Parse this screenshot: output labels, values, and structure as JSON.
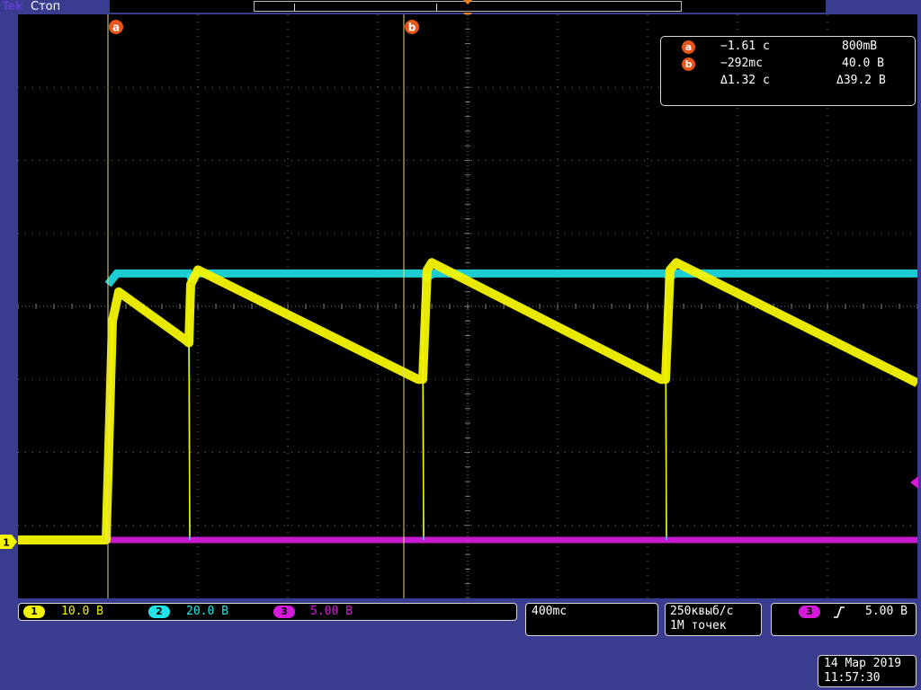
{
  "top": {
    "logo": "Tek",
    "state": "Стоп"
  },
  "cursors": {
    "a_label": "a",
    "b_label": "b",
    "a_time": "−1.61 с",
    "a_value": "800mB",
    "b_time": "−292mс",
    "b_value": "40.0 B",
    "delta_time": "Δ1.32 с",
    "delta_value": "Δ39.2 B"
  },
  "channels": [
    {
      "num": "1",
      "scale": "10.0 B",
      "color": "#f5f500"
    },
    {
      "num": "2",
      "scale": "20.0 B",
      "color": "#1ee3e8"
    },
    {
      "num": "3",
      "scale": "5.00 B",
      "color": "#d21ad8"
    }
  ],
  "ground_marker": "1",
  "horizontal": {
    "scale": "400mс"
  },
  "acquisition": {
    "rate": "250квыб/с",
    "points": "1M точек"
  },
  "trigger": {
    "channel": "3",
    "slope_icon": "rising-edge-icon",
    "level": "5.00 B"
  },
  "datetime": {
    "date": "14 Мар 2019",
    "time": "11:57:30"
  },
  "colors": {
    "background_frame": "#3a3c8f",
    "graticule": "#7a7a7a",
    "cursor_line": "#e0d890",
    "cursor_badge": "#e8551a",
    "trigger_marker": "#f08020"
  },
  "chart_data": {
    "type": "line",
    "x_divisions": 10,
    "y_divisions": 8,
    "time_per_div_s": 0.4,
    "series": [
      {
        "name": "1",
        "color": "#f5f500",
        "description_points_div": [
          [
            0,
            0.8
          ],
          [
            0.98,
            0.8
          ],
          [
            1.05,
            3.8
          ],
          [
            1.12,
            4.2
          ],
          [
            1.85,
            3.55
          ],
          [
            1.9,
            3.5
          ],
          [
            1.92,
            4.3
          ],
          [
            2.0,
            4.5
          ],
          [
            4.45,
            3.0
          ],
          [
            4.5,
            3.0
          ],
          [
            4.55,
            4.5
          ],
          [
            4.6,
            4.6
          ],
          [
            7.15,
            3.0
          ],
          [
            7.2,
            3.0
          ],
          [
            7.25,
            4.5
          ],
          [
            7.32,
            4.6
          ],
          [
            10,
            2.95
          ]
        ]
      },
      {
        "name": "2",
        "color": "#1ee3e8",
        "description_points_div": [
          [
            1.0,
            4.3
          ],
          [
            1.1,
            4.45
          ],
          [
            1.9,
            4.45
          ],
          [
            1.92,
            4.4
          ],
          [
            2.0,
            4.45
          ],
          [
            4.5,
            4.45
          ],
          [
            4.55,
            4.4
          ],
          [
            4.62,
            4.45
          ],
          [
            7.2,
            4.45
          ],
          [
            7.25,
            4.4
          ],
          [
            7.3,
            4.45
          ],
          [
            10,
            4.45
          ]
        ]
      },
      {
        "name": "3",
        "color": "#d21ad8",
        "description_points_div": [
          [
            1.0,
            0.8
          ],
          [
            10,
            0.8
          ]
        ]
      }
    ],
    "dips_at_div": [
      1.9,
      4.5,
      7.2
    ],
    "cursor_a_div": 1.0,
    "cursor_b_div": 4.29
  }
}
